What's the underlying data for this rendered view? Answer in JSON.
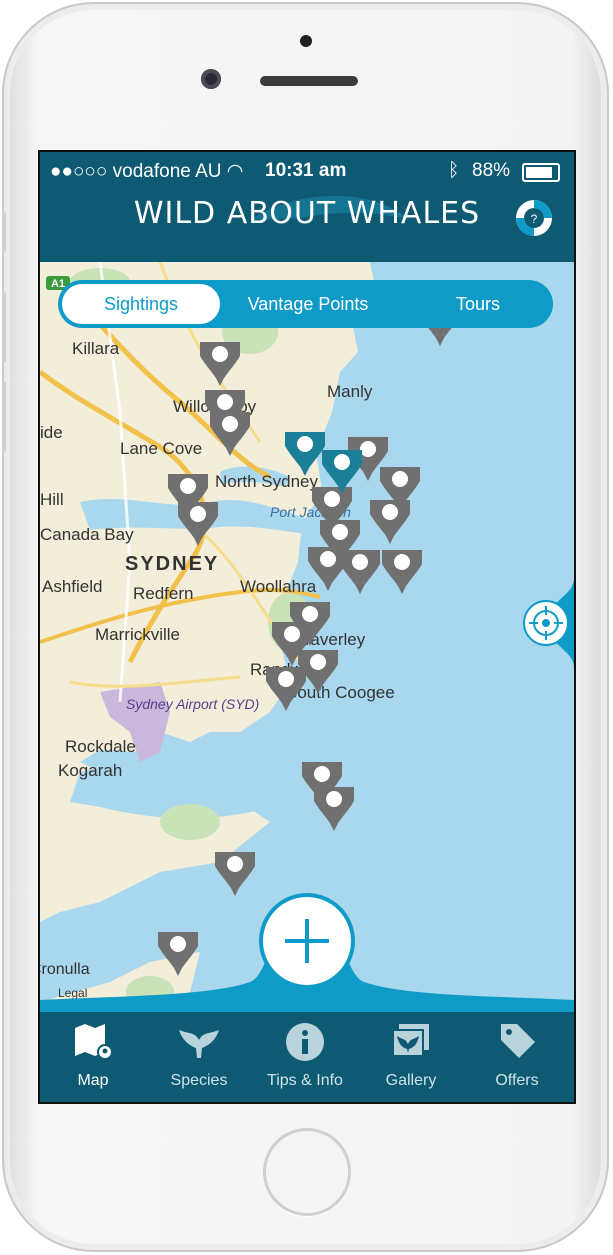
{
  "status": {
    "carrier": "vodafone AU",
    "time": "10:31 am",
    "battery": "88%"
  },
  "app": {
    "title": "WILD ABOUT WHALES"
  },
  "tabs": [
    {
      "label": "Sightings",
      "active": true
    },
    {
      "label": "Vantage Points",
      "active": false
    },
    {
      "label": "Tours",
      "active": false
    }
  ],
  "map": {
    "labels": [
      "Killara",
      "Manly",
      "Lane Cove",
      "Willoughby",
      "North Sydney",
      "Port Jackson",
      "Canada Bay",
      "SYDNEY",
      "Ashfield",
      "Redfern",
      "Woollahra",
      "Marrickville",
      "Waverley",
      "Randwick",
      "South Coogee",
      "Sydney Airport (SYD)",
      "Rockdale",
      "Kogarah",
      "Cronulla",
      "Hill",
      "ide",
      "Legal"
    ],
    "road_shield": "A1"
  },
  "nav": [
    {
      "label": "Map",
      "icon": "map-icon",
      "active": true
    },
    {
      "label": "Species",
      "icon": "whale-tail-icon",
      "active": false
    },
    {
      "label": "Tips & Info",
      "icon": "info-icon",
      "active": false
    },
    {
      "label": "Gallery",
      "icon": "gallery-icon",
      "active": false
    },
    {
      "label": "Offers",
      "icon": "tag-icon",
      "active": false
    }
  ],
  "colors": {
    "header": "#0e5a73",
    "accent": "#0f9bc7",
    "marker": "#6f6f6f",
    "marker_selected": "#1b7f97"
  }
}
